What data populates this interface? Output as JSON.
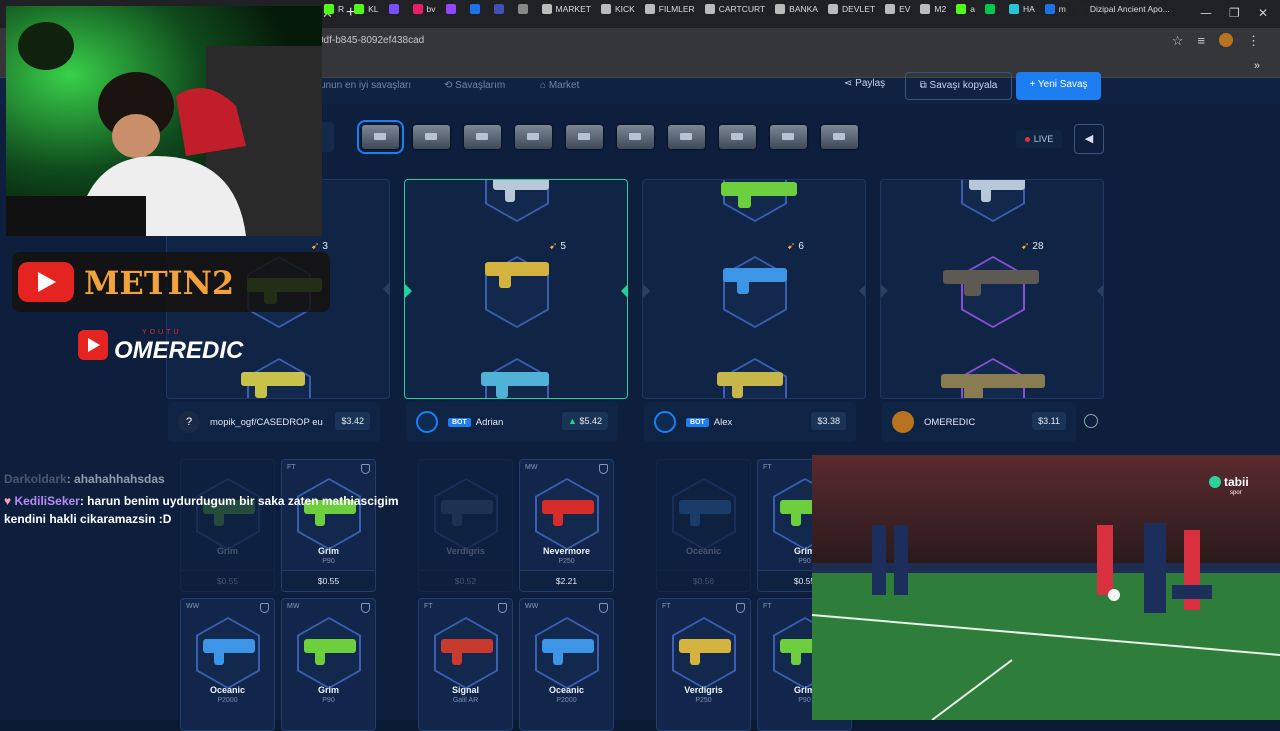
{
  "browser": {
    "url": "0df-b845-8092ef438cad",
    "bookmarks": [
      {
        "label": "R",
        "color": "#53fc18"
      },
      {
        "label": "KL",
        "color": "#53fc18"
      },
      {
        "label": "",
        "color": "#7c4dff"
      },
      {
        "label": "bv",
        "color": "#e91e63"
      },
      {
        "label": "",
        "color": "#9146ff"
      },
      {
        "label": "",
        "color": "#1a73e8"
      },
      {
        "label": "",
        "color": "#3f51b5"
      },
      {
        "label": "",
        "color": "#888888"
      },
      {
        "label": "MARKET",
        "color": "#bbbbbb"
      },
      {
        "label": "KICK",
        "color": "#bbbbbb"
      },
      {
        "label": "FILMLER",
        "color": "#bbbbbb"
      },
      {
        "label": "CARTCURT",
        "color": "#bbbbbb"
      },
      {
        "label": "BANKA",
        "color": "#bbbbbb"
      },
      {
        "label": "DEVLET",
        "color": "#bbbbbb"
      },
      {
        "label": "EV",
        "color": "#bbbbbb"
      },
      {
        "label": "M2",
        "color": "#bbbbbb"
      },
      {
        "label": "a",
        "color": "#53fc18"
      },
      {
        "label": "",
        "color": "#00c853"
      },
      {
        "label": "HA",
        "color": "#26c6da"
      },
      {
        "label": "m",
        "color": "#1a73e8"
      },
      {
        "label": "Dizipal Ancient Apo...",
        "color": "#222222"
      }
    ]
  },
  "nav": {
    "link1": "unun en iyi savaşları",
    "link2": "Savaşlarım",
    "link3": "Market",
    "share": "Paylaş",
    "copy": "Savaşı kopyala",
    "new": "Yeni Savaş"
  },
  "live": "LIVE",
  "lanes": [
    {
      "count": "3"
    },
    {
      "count": "5"
    },
    {
      "count": "6"
    },
    {
      "count": "28"
    }
  ],
  "players": [
    {
      "name": "mopik_ogf/CASEDROP eu",
      "price": "$3.42",
      "bot": ""
    },
    {
      "name": "Adrian",
      "price": "$5.42",
      "bot": "BOT"
    },
    {
      "name": "Alex",
      "price": "$3.38",
      "bot": "BOT"
    },
    {
      "name": "OMEREDIC",
      "price": "$3.11",
      "bot": ""
    }
  ],
  "cards": [
    {
      "tag": "",
      "name": "Grim",
      "sub": "",
      "price": "$0.55"
    },
    {
      "tag": "FT",
      "name": "Grim",
      "sub": "P90",
      "price": "$0.55"
    },
    {
      "tag": "",
      "name": "Verdigris",
      "sub": "",
      "price": "$0.52"
    },
    {
      "tag": "MW",
      "name": "Nevermore",
      "sub": "P250",
      "price": "$2.21"
    },
    {
      "tag": "",
      "name": "Oceanic",
      "sub": "",
      "price": "$0.56"
    },
    {
      "tag": "FT",
      "name": "Grim",
      "sub": "P90",
      "price": "$0.55"
    },
    {
      "tag": "WW",
      "name": "Oceanic",
      "sub": "P2000",
      "price": ""
    },
    {
      "tag": "MW",
      "name": "Grim",
      "sub": "P90",
      "price": ""
    },
    {
      "tag": "FT",
      "name": "Signal",
      "sub": "Galil AR",
      "price": ""
    },
    {
      "tag": "WW",
      "name": "Oceanic",
      "sub": "P2000",
      "price": ""
    },
    {
      "tag": "FT",
      "name": "Verdigris",
      "sub": "P250",
      "price": ""
    },
    {
      "tag": "FT",
      "name": "Grim",
      "sub": "P90",
      "price": ""
    }
  ],
  "overlay": {
    "logo1": "METIN2",
    "logo2": "OMEREDIC",
    "logo2_small": "YOUTU",
    "tv": "tabii",
    "tv_sub": "spor"
  },
  "chat": [
    {
      "user": "Darkoldark",
      "text": ": ahahahhahsdas"
    },
    {
      "user": "KediliSeker",
      "text": ": harun benim uydurdugum bir saka zaten mathiascigim kendini hakli cikaramazsin :D"
    }
  ]
}
